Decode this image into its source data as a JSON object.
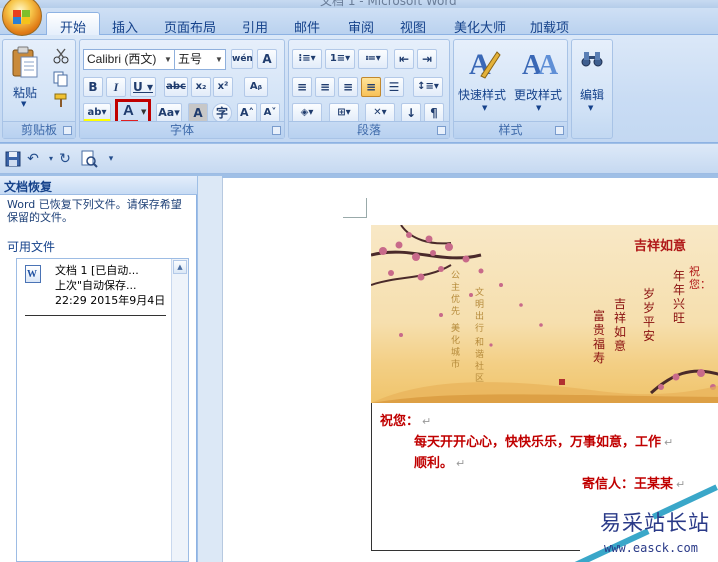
{
  "window": {
    "title": "文档 1 - Microsoft Word"
  },
  "tabs": [
    {
      "label": "开始",
      "active": true
    },
    {
      "label": "插入"
    },
    {
      "label": "页面布局"
    },
    {
      "label": "引用"
    },
    {
      "label": "邮件"
    },
    {
      "label": "审阅"
    },
    {
      "label": "视图"
    },
    {
      "label": "美化大师"
    },
    {
      "label": "加载项"
    }
  ],
  "ribbon": {
    "clipboard": {
      "label": "剪贴板",
      "paste_label": "粘贴"
    },
    "font": {
      "label": "字体",
      "font_name": "Calibri (西文)",
      "font_size": "五号",
      "highlighted_tool": "font-color",
      "highlight_color": "#c00000",
      "font_color_bar": "#e02020"
    },
    "paragraph": {
      "label": "段落"
    },
    "styles": {
      "label": "样式",
      "quick_styles_label": "快速样式",
      "change_styles_label": "更改样式"
    },
    "editing": {
      "label": "编辑"
    }
  },
  "recovery_pane": {
    "title": "文档恢复",
    "message": "Word 已恢复下列文件。请保存希望保留的文件。",
    "subtitle": "可用文件",
    "file": {
      "name": "文档 1  [已自动...",
      "desc": "上次\"自动保存...",
      "time": "22:29 2015年9月4日"
    }
  },
  "document": {
    "card_text": {
      "title": "吉祥如意",
      "greeting_top": "祝您：",
      "lines": [
        "年年兴旺",
        "岁岁平安",
        "吉祥如意",
        "富贵福寿"
      ],
      "poem_col1": [
        "公主优先",
        "美化城市"
      ],
      "poem_col2": [
        "文明出行",
        "和谐社区"
      ]
    },
    "letter": {
      "salutation": "祝您：",
      "body_line1": "每天开开心心，快快乐乐，万事如意，工作",
      "body_line2": "顺利。",
      "signature": "寄信人：王某某",
      "paragraph_mark": "↵"
    }
  },
  "watermark": {
    "text": "易采站长站",
    "url": "www.easck.com"
  }
}
